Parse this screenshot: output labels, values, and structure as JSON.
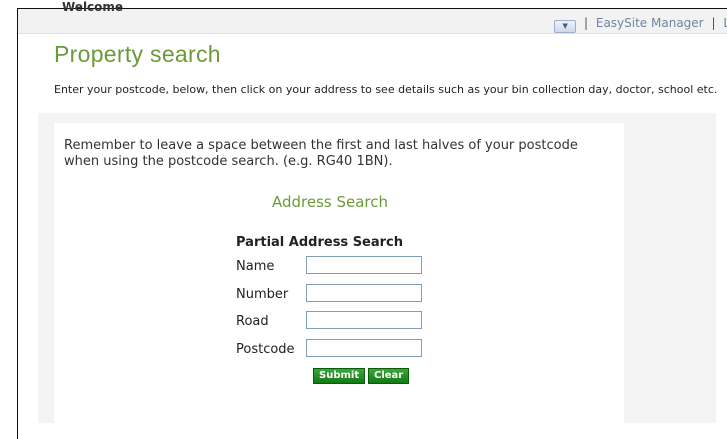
{
  "header": {
    "welcome": "Welcome",
    "links": [
      "EasySite Manager",
      "L"
    ]
  },
  "page": {
    "title": "Property search",
    "intro": "Enter your postcode, below, then click on your address to see details such as your bin collection day, doctor, school etc."
  },
  "search": {
    "remember": "Remember to leave a space between the first and last halves of your postcode when using the postcode search. (e.g. RG40 1BN).",
    "heading": "Address Search",
    "partial_heading": "Partial Address Search",
    "fields": {
      "name": {
        "label": "Name",
        "value": ""
      },
      "number": {
        "label": "Number",
        "value": ""
      },
      "road": {
        "label": "Road",
        "value": ""
      },
      "postcode": {
        "label": "Postcode",
        "value": ""
      }
    },
    "submit_label": "Submit",
    "clear_label": "Clear"
  }
}
